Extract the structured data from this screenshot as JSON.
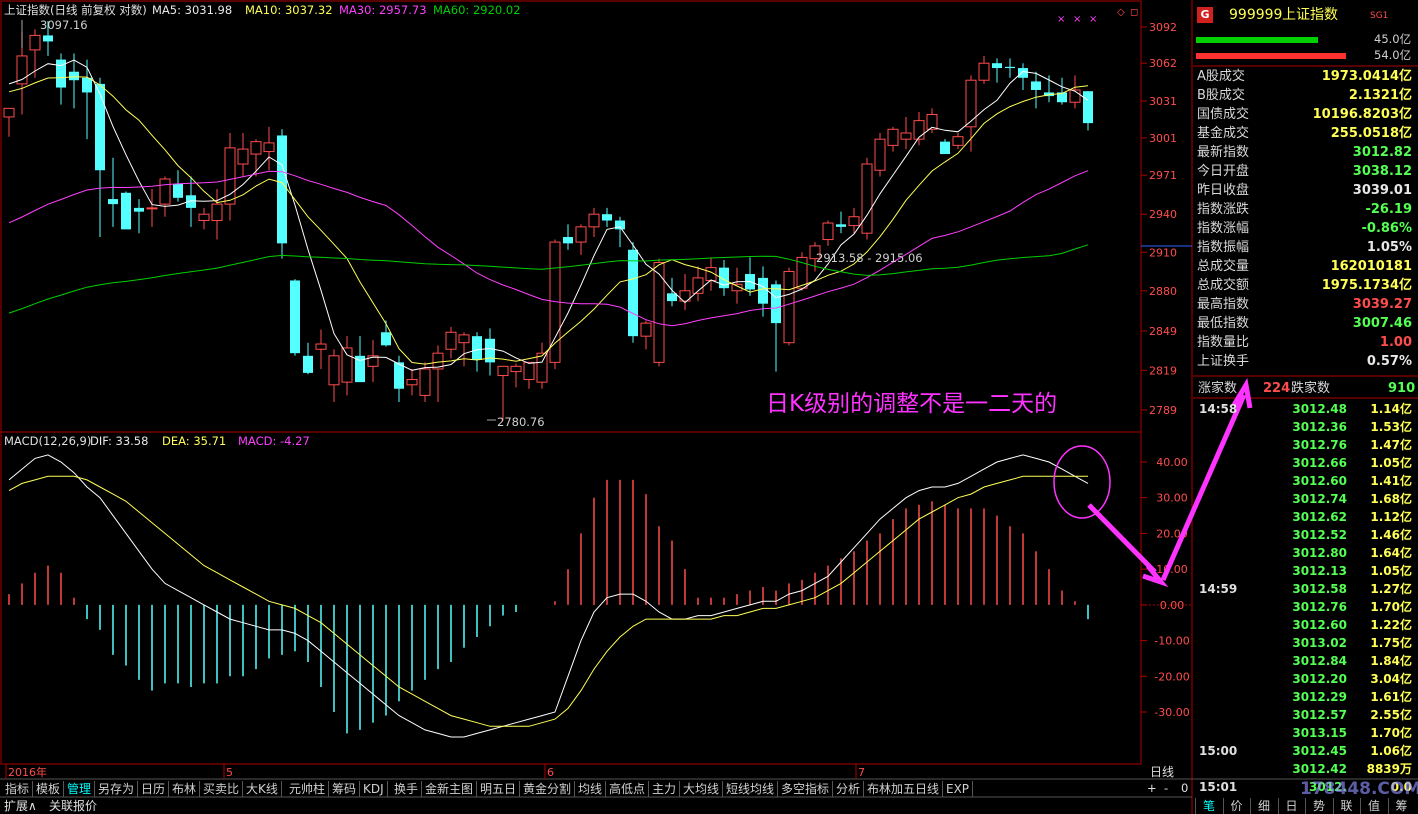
{
  "header": {
    "index_label": "上证指数(日线 前复权 对数)",
    "ma5": "MA5: 3031.98",
    "ma10": "MA10: 3037.32",
    "ma30": "MA30: 2957.73",
    "ma60": "MA60: 2920.02"
  },
  "macd_header": {
    "label": "MACD(12,26,9)",
    "dif": "DIF: 33.58",
    "dea": "DEA: 35.71",
    "macd": "MACD: -4.27"
  },
  "annotations": {
    "high_label": "3097.16",
    "low_label": "2780.76",
    "cross_label": "2913.58 - 2915.06",
    "comment": "日K级别的调整不是一二天的"
  },
  "colors": {
    "up": "#ff4c4c",
    "down": "#54ffff",
    "ma5": "#ffffff",
    "ma10": "#ffff55",
    "ma30": "#ff40ff",
    "ma60": "#00d000",
    "frame": "#b00000",
    "arrow": "#ff33ff"
  },
  "chart_data": [
    {
      "type": "candlestick",
      "title": "上证指数(日线 前复权 对数)",
      "y_ticks": [
        "3092",
        "3062",
        "3031",
        "3001",
        "2971",
        "2940",
        "2910",
        "2880",
        "2849",
        "2819",
        "2789"
      ],
      "x_labels": [
        "2016年",
        "5",
        "6",
        "7"
      ],
      "ylim": [
        2780,
        3100
      ],
      "candles": [
        {
          "o": 3018,
          "h": 3024,
          "l": 3002,
          "c": 3025
        },
        {
          "o": 3045,
          "h": 3088,
          "l": 3020,
          "c": 3068
        },
        {
          "o": 3073,
          "h": 3090,
          "l": 3050,
          "c": 3085
        },
        {
          "o": 3085,
          "h": 3097,
          "l": 3068,
          "c": 3080
        },
        {
          "o": 3065,
          "h": 3070,
          "l": 3028,
          "c": 3042
        },
        {
          "o": 3055,
          "h": 3070,
          "l": 3025,
          "c": 3048
        },
        {
          "o": 3050,
          "h": 3065,
          "l": 3000,
          "c": 3038
        },
        {
          "o": 3045,
          "h": 3050,
          "l": 2922,
          "c": 2975
        },
        {
          "o": 2952,
          "h": 2985,
          "l": 2930,
          "c": 2948
        },
        {
          "o": 2957,
          "h": 2958,
          "l": 2932,
          "c": 2928
        },
        {
          "o": 2945,
          "h": 2952,
          "l": 2925,
          "c": 2942
        },
        {
          "o": 2945,
          "h": 2960,
          "l": 2930,
          "c": 2945
        },
        {
          "o": 2948,
          "h": 2970,
          "l": 2938,
          "c": 2968
        },
        {
          "o": 2964,
          "h": 2975,
          "l": 2950,
          "c": 2953
        },
        {
          "o": 2955,
          "h": 2970,
          "l": 2930,
          "c": 2945
        },
        {
          "o": 2935,
          "h": 2945,
          "l": 2928,
          "c": 2940
        },
        {
          "o": 2935,
          "h": 2960,
          "l": 2920,
          "c": 2948
        },
        {
          "o": 2948,
          "h": 3005,
          "l": 2935,
          "c": 2993
        },
        {
          "o": 2980,
          "h": 3005,
          "l": 2970,
          "c": 2992
        },
        {
          "o": 2988,
          "h": 3000,
          "l": 2970,
          "c": 2998
        },
        {
          "o": 2990,
          "h": 3010,
          "l": 2975,
          "c": 2997
        },
        {
          "o": 3003,
          "h": 3008,
          "l": 2905,
          "c": 2917
        },
        {
          "o": 2888,
          "h": 2889,
          "l": 2830,
          "c": 2832
        },
        {
          "o": 2830,
          "h": 2840,
          "l": 2816,
          "c": 2817
        },
        {
          "o": 2835,
          "h": 2850,
          "l": 2820,
          "c": 2839
        },
        {
          "o": 2808,
          "h": 2835,
          "l": 2795,
          "c": 2830
        },
        {
          "o": 2810,
          "h": 2845,
          "l": 2800,
          "c": 2836
        },
        {
          "o": 2830,
          "h": 2845,
          "l": 2818,
          "c": 2810
        },
        {
          "o": 2822,
          "h": 2842,
          "l": 2810,
          "c": 2830
        },
        {
          "o": 2848,
          "h": 2857,
          "l": 2837,
          "c": 2838
        },
        {
          "o": 2825,
          "h": 2830,
          "l": 2795,
          "c": 2805
        },
        {
          "o": 2808,
          "h": 2820,
          "l": 2800,
          "c": 2812
        },
        {
          "o": 2800,
          "h": 2825,
          "l": 2795,
          "c": 2820
        },
        {
          "o": 2820,
          "h": 2838,
          "l": 2795,
          "c": 2832
        },
        {
          "o": 2835,
          "h": 2852,
          "l": 2828,
          "c": 2848
        },
        {
          "o": 2840,
          "h": 2848,
          "l": 2822,
          "c": 2846
        },
        {
          "o": 2845,
          "h": 2848,
          "l": 2818,
          "c": 2827
        },
        {
          "o": 2843,
          "h": 2851,
          "l": 2815,
          "c": 2825
        },
        {
          "o": 2815,
          "h": 2822,
          "l": 2781,
          "c": 2822
        },
        {
          "o": 2818,
          "h": 2824,
          "l": 2806,
          "c": 2822
        },
        {
          "o": 2812,
          "h": 2822,
          "l": 2805,
          "c": 2825
        },
        {
          "o": 2810,
          "h": 2840,
          "l": 2805,
          "c": 2832
        },
        {
          "o": 2825,
          "h": 2920,
          "l": 2820,
          "c": 2918
        },
        {
          "o": 2922,
          "h": 2932,
          "l": 2912,
          "c": 2917
        },
        {
          "o": 2918,
          "h": 2932,
          "l": 2908,
          "c": 2930
        },
        {
          "o": 2930,
          "h": 2945,
          "l": 2922,
          "c": 2940
        },
        {
          "o": 2940,
          "h": 2945,
          "l": 2930,
          "c": 2935
        },
        {
          "o": 2935,
          "h": 2938,
          "l": 2914,
          "c": 2928
        },
        {
          "o": 2912,
          "h": 2918,
          "l": 2840,
          "c": 2845
        },
        {
          "o": 2845,
          "h": 2857,
          "l": 2835,
          "c": 2855
        },
        {
          "o": 2825,
          "h": 2905,
          "l": 2822,
          "c": 2902
        },
        {
          "o": 2878,
          "h": 2890,
          "l": 2868,
          "c": 2872
        },
        {
          "o": 2872,
          "h": 2893,
          "l": 2865,
          "c": 2880
        },
        {
          "o": 2878,
          "h": 2899,
          "l": 2872,
          "c": 2890
        },
        {
          "o": 2888,
          "h": 2906,
          "l": 2880,
          "c": 2898
        },
        {
          "o": 2898,
          "h": 2904,
          "l": 2876,
          "c": 2882
        },
        {
          "o": 2880,
          "h": 2898,
          "l": 2870,
          "c": 2885
        },
        {
          "o": 2893,
          "h": 2906,
          "l": 2876,
          "c": 2881
        },
        {
          "o": 2890,
          "h": 2899,
          "l": 2860,
          "c": 2870
        },
        {
          "o": 2885,
          "h": 2888,
          "l": 2818,
          "c": 2855
        },
        {
          "o": 2840,
          "h": 2898,
          "l": 2838,
          "c": 2895
        },
        {
          "o": 2882,
          "h": 2910,
          "l": 2880,
          "c": 2906
        },
        {
          "o": 2905,
          "h": 2918,
          "l": 2895,
          "c": 2915
        },
        {
          "o": 2920,
          "h": 2935,
          "l": 2915,
          "c": 2933
        },
        {
          "o": 2932,
          "h": 2942,
          "l": 2925,
          "c": 2930
        },
        {
          "o": 2931,
          "h": 2945,
          "l": 2925,
          "c": 2938
        },
        {
          "o": 2925,
          "h": 2985,
          "l": 2920,
          "c": 2980
        },
        {
          "o": 2975,
          "h": 3005,
          "l": 2970,
          "c": 3000
        },
        {
          "o": 2995,
          "h": 3010,
          "l": 2990,
          "c": 3008
        },
        {
          "o": 3000,
          "h": 3018,
          "l": 2992,
          "c": 3005
        },
        {
          "o": 3000,
          "h": 3022,
          "l": 2995,
          "c": 3015
        },
        {
          "o": 3008,
          "h": 3025,
          "l": 3005,
          "c": 3020
        },
        {
          "o": 2998,
          "h": 3000,
          "l": 2988,
          "c": 2988
        },
        {
          "o": 2995,
          "h": 3005,
          "l": 2992,
          "c": 3002
        },
        {
          "o": 3010,
          "h": 3052,
          "l": 2990,
          "c": 3048
        },
        {
          "o": 3048,
          "h": 3068,
          "l": 3045,
          "c": 3062
        },
        {
          "o": 3062,
          "h": 3066,
          "l": 3046,
          "c": 3058
        },
        {
          "o": 3059,
          "h": 3066,
          "l": 3050,
          "c": 3058
        },
        {
          "o": 3058,
          "h": 3062,
          "l": 3040,
          "c": 3050
        },
        {
          "o": 3047,
          "h": 3055,
          "l": 3025,
          "c": 3040
        },
        {
          "o": 3038,
          "h": 3052,
          "l": 3030,
          "c": 3035
        },
        {
          "o": 3038,
          "h": 3050,
          "l": 3028,
          "c": 3030
        },
        {
          "o": 3030,
          "h": 3052,
          "l": 3025,
          "c": 3040
        },
        {
          "o": 3039,
          "h": 3039,
          "l": 3007,
          "c": 3013
        }
      ]
    },
    {
      "type": "line",
      "title": "MACD(12,26,9)",
      "y_ticks": [
        "40.00",
        "30.00",
        "20.00",
        "10.00",
        "0.00",
        "-10.00",
        "-20.00",
        "-30.00"
      ],
      "ylim": [
        -42,
        46
      ],
      "series": [
        {
          "name": "DIF",
          "values": [
            35,
            38,
            41,
            42,
            40,
            37,
            33,
            30,
            25,
            20,
            15,
            10,
            6,
            4,
            2,
            0,
            -2,
            -4,
            -5,
            -6,
            -7,
            -7,
            -8,
            -10,
            -13,
            -16,
            -19,
            -22,
            -25,
            -28,
            -31,
            -33,
            -35,
            -36,
            -37,
            -37,
            -36,
            -35,
            -34,
            -33,
            -32,
            -31,
            -30,
            -20,
            -10,
            -2,
            2,
            3,
            3,
            1,
            -2,
            -4,
            -4,
            -3,
            -3,
            -2,
            -1,
            0,
            1,
            1,
            3,
            4,
            6,
            8,
            12,
            16,
            20,
            24,
            27,
            30,
            32,
            33,
            33,
            34,
            36,
            38,
            40,
            41,
            42,
            41,
            40,
            38,
            36,
            34
          ]
        },
        {
          "name": "DEA",
          "values": [
            32,
            34,
            35,
            36,
            36,
            36,
            35,
            33,
            31,
            29,
            26,
            23,
            20,
            17,
            14,
            11,
            9,
            7,
            5,
            3,
            1,
            0,
            -1,
            -3,
            -5,
            -8,
            -11,
            -14,
            -17,
            -20,
            -23,
            -25,
            -27,
            -29,
            -31,
            -32,
            -33,
            -34,
            -34,
            -34,
            -34,
            -33,
            -32,
            -29,
            -24,
            -18,
            -13,
            -9,
            -6,
            -4,
            -4,
            -4,
            -4,
            -4,
            -4,
            -3,
            -3,
            -2,
            -1,
            -1,
            0,
            1,
            2,
            4,
            6,
            9,
            12,
            15,
            18,
            21,
            24,
            26,
            28,
            30,
            31,
            33,
            34,
            35,
            36,
            36,
            36,
            36,
            36,
            36
          ]
        },
        {
          "name": "MACD",
          "values": [
            3,
            6,
            9,
            11,
            9,
            2,
            -4,
            -7,
            -14,
            -17,
            -21,
            -24,
            -22,
            -22,
            -23,
            -22,
            -22,
            -20,
            -20,
            -18,
            -15,
            -14,
            -13,
            -16,
            -23,
            -30,
            -36,
            -35,
            -33,
            -31,
            -27,
            -24,
            -21,
            -18,
            -16,
            -12,
            -9,
            -6,
            -3,
            -2,
            0,
            0,
            1,
            10,
            20,
            30,
            35,
            35,
            35,
            31,
            22,
            18,
            10,
            2,
            2,
            2,
            3,
            4,
            5,
            4,
            6,
            7,
            9,
            11,
            13,
            15,
            18,
            20,
            24,
            27,
            28,
            29,
            28,
            27,
            27,
            27,
            25,
            22,
            20,
            15,
            10,
            4,
            1,
            -4
          ]
        }
      ]
    }
  ],
  "right_panel": {
    "badge": "G",
    "code": "999999",
    "name": "上证指数",
    "tag": "SG1",
    "bar1_label": "45.0亿",
    "bar2_label": "54.0亿",
    "rows": [
      {
        "k": "A股成交",
        "v": "1973.0414亿",
        "c": "#ffff55"
      },
      {
        "k": "B股成交",
        "v": "2.1321亿",
        "c": "#ffff55"
      },
      {
        "k": "国债成交",
        "v": "10196.8203亿",
        "c": "#ffff55"
      },
      {
        "k": "基金成交",
        "v": "255.0518亿",
        "c": "#ffff55"
      },
      {
        "k": "最新指数",
        "v": "3012.82",
        "c": "#54ff54"
      },
      {
        "k": "今日开盘",
        "v": "3038.12",
        "c": "#54ff54"
      },
      {
        "k": "昨日收盘",
        "v": "3039.01",
        "c": "#e8e8e8"
      },
      {
        "k": "指数涨跌",
        "v": "-26.19",
        "c": "#54ff54"
      },
      {
        "k": "指数涨幅",
        "v": "-0.86%",
        "c": "#54ff54"
      },
      {
        "k": "指数振幅",
        "v": "1.05%",
        "c": "#e8e8e8"
      },
      {
        "k": "总成交量",
        "v": "162010181",
        "c": "#ffff55"
      },
      {
        "k": "总成交额",
        "v": "1975.1734亿",
        "c": "#ffff55"
      },
      {
        "k": "最高指数",
        "v": "3039.27",
        "c": "#ff4c4c"
      },
      {
        "k": "最低指数",
        "v": "3007.46",
        "c": "#54ff54"
      },
      {
        "k": "指数量比",
        "v": "1.00",
        "c": "#ff4c4c"
      },
      {
        "k": "上证换手",
        "v": "0.57%",
        "c": "#e8e8e8"
      }
    ],
    "updown_label_up": "涨家数",
    "up_count": "224",
    "updown_label_down": "跌家数",
    "down_count": "910",
    "ticks": [
      {
        "t": "14:58",
        "p": "3012.48",
        "v": "1.14亿"
      },
      {
        "t": "",
        "p": "3012.36",
        "v": "1.53亿"
      },
      {
        "t": "",
        "p": "3012.76",
        "v": "1.47亿"
      },
      {
        "t": "",
        "p": "3012.66",
        "v": "1.05亿"
      },
      {
        "t": "",
        "p": "3012.60",
        "v": "1.41亿"
      },
      {
        "t": "",
        "p": "3012.74",
        "v": "1.68亿"
      },
      {
        "t": "",
        "p": "3012.62",
        "v": "1.12亿"
      },
      {
        "t": "",
        "p": "3012.52",
        "v": "1.46亿"
      },
      {
        "t": "",
        "p": "3012.80",
        "v": "1.64亿"
      },
      {
        "t": "",
        "p": "3012.13",
        "v": "1.05亿"
      },
      {
        "t": "14:59",
        "p": "3012.58",
        "v": "1.27亿"
      },
      {
        "t": "",
        "p": "3012.76",
        "v": "1.70亿"
      },
      {
        "t": "",
        "p": "3012.60",
        "v": "1.22亿"
      },
      {
        "t": "",
        "p": "3013.02",
        "v": "1.75亿"
      },
      {
        "t": "",
        "p": "3012.84",
        "v": "1.84亿"
      },
      {
        "t": "",
        "p": "3012.20",
        "v": "3.04亿"
      },
      {
        "t": "",
        "p": "3012.29",
        "v": "1.61亿"
      },
      {
        "t": "",
        "p": "3012.57",
        "v": "2.55亿"
      },
      {
        "t": "",
        "p": "3013.15",
        "v": "1.70亿"
      },
      {
        "t": "15:00",
        "p": "3012.45",
        "v": "1.06亿"
      },
      {
        "t": "",
        "p": "3012.42",
        "v": "8839万"
      },
      {
        "t": "15:01",
        "p": "3012.",
        "v": "0.0"
      }
    ],
    "watermark": "178448.COM",
    "bottom_tabs": [
      "笔",
      "价",
      "细",
      "日",
      "势",
      "联",
      "值",
      "筹"
    ]
  },
  "period_label": "日线",
  "zoom_buttons": [
    "+",
    "-",
    "0"
  ],
  "tabs": [
    "指标",
    "模板",
    "管理",
    "另存为",
    "日历",
    "布林",
    "买卖比",
    "大K线",
    "元帅柱",
    "筹码",
    "KDJ",
    "换手",
    "金新主图",
    "明五日",
    "黄金分割",
    "均线",
    "高低点",
    "主力",
    "大均线",
    "短线均线",
    "多空指标",
    "分析",
    "布林加五日线",
    "EXP"
  ],
  "bottom_tabs": [
    "扩展∧",
    "关联报价"
  ]
}
